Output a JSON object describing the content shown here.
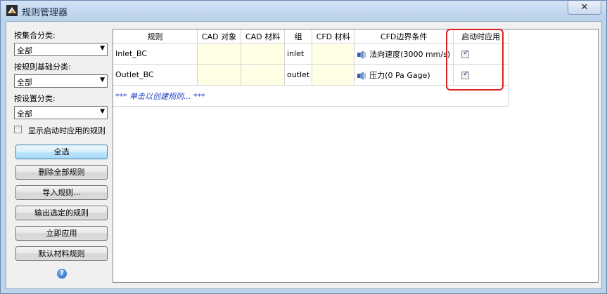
{
  "window": {
    "title": "规则管理器",
    "close_glyph": "✕"
  },
  "left": {
    "cat1_label": "按集合分类:",
    "cat1_value": "全部",
    "cat2_label": "按规则基础分类:",
    "cat2_value": "全部",
    "cat3_label": "按设置分类:",
    "cat3_value": "全部",
    "combo_arrow": "▼",
    "show_startup_label": "显示启动时应用的规则",
    "buttons": {
      "select_all": "全选",
      "delete_all": "删除全部规则",
      "import": "导入规则...",
      "export": "输出选定的规则",
      "apply_now": "立即应用",
      "default_material": "默认材料规则"
    },
    "help_glyph": "?"
  },
  "table": {
    "headers": [
      "规则",
      "CAD 对象",
      "CAD 材料",
      "组",
      "CFD 材料",
      "CFD边界条件",
      "启动时应用"
    ],
    "rows": [
      {
        "rule": "Inlet_BC",
        "cad_object": "",
        "cad_material": "",
        "group": "inlet",
        "cfd_material": "",
        "cfd_bc": "法向速度(3000 mm/s)",
        "apply_on_startup": true
      },
      {
        "rule": "Outlet_BC",
        "cad_object": "",
        "cad_material": "",
        "group": "outlet",
        "cfd_material": "",
        "cfd_bc": "压力(0 Pa Gage)",
        "apply_on_startup": true
      }
    ],
    "create_hint": "*** 单击以创建规则... ***",
    "check_glyph": "✓"
  },
  "colors": {
    "highlight": "#e02020",
    "hint_text": "#1a3fc4",
    "empty_cell": "#ffffe6"
  }
}
